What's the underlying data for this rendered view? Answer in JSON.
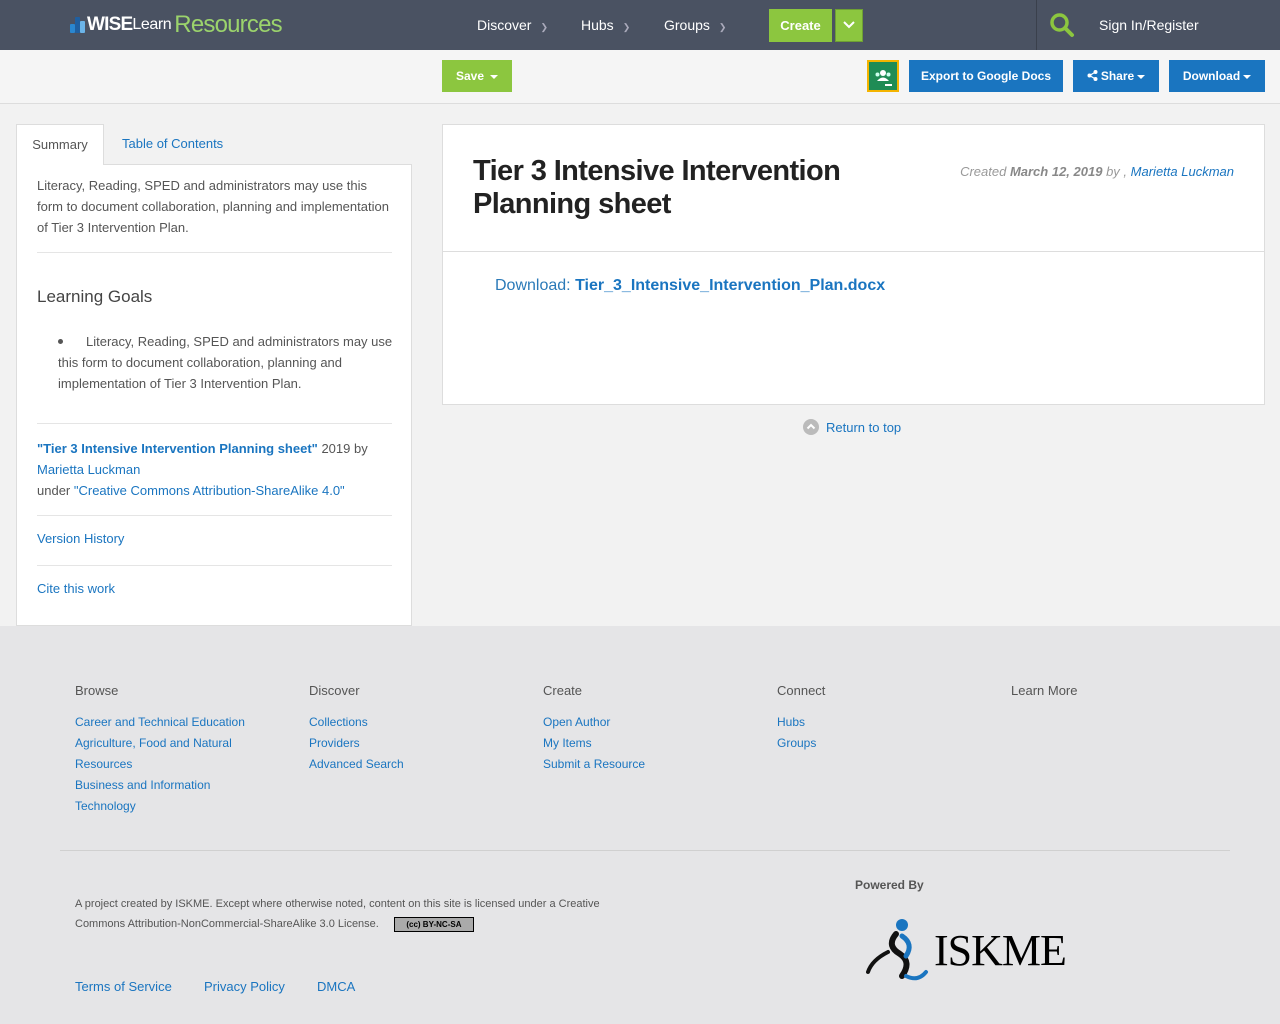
{
  "header": {
    "logo": {
      "wise": "WISE",
      "learn": "Learn",
      "resources": "Resources"
    },
    "nav": [
      {
        "label": "Discover"
      },
      {
        "label": "Hubs"
      },
      {
        "label": "Groups"
      }
    ],
    "create_label": "Create",
    "signin_label": "Sign In/Register"
  },
  "toolbar": {
    "save_label": "Save",
    "export_label": "Export to Google Docs",
    "share_label": "Share",
    "download_label": "Download"
  },
  "sidebar": {
    "tabs": {
      "summary": "Summary",
      "toc": "Table of Contents"
    },
    "summary_text": "Literacy, Reading, SPED and administrators may use this form to document collaboration, planning and implementation of Tier 3 Intervention Plan.",
    "learning_goals_heading": "Learning Goals",
    "learning_goals": [
      "Literacy, Reading, SPED and administrators may use this form to document collaboration, planning and implementation of Tier 3 Intervention Plan."
    ],
    "attribution": {
      "title": "\"Tier 3 Intensive Intervention Planning sheet\"",
      "year_by": "2019 by",
      "author": "Marietta Luckman",
      "under": "under",
      "license": "\"Creative Commons Attribution-ShareAlike 4.0\""
    },
    "version_history": "Version History",
    "cite": "Cite this work"
  },
  "resource": {
    "title": "Tier 3 Intensive Intervention Planning sheet",
    "created_prefix": "Created",
    "created_date": "March 12, 2019",
    "by": "by ,",
    "author": "Marietta Luckman",
    "download_prefix": "Download:",
    "download_file": "Tier_3_Intensive_Intervention_Plan.docx"
  },
  "return_to_top": "Return to top",
  "footer": {
    "columns": [
      {
        "heading": "Browse",
        "links": [
          "Career and Technical Education",
          "Agriculture, Food and Natural Resources",
          "Business and Information Technology"
        ]
      },
      {
        "heading": "Discover",
        "links": [
          "Collections",
          "Providers",
          "Advanced Search"
        ]
      },
      {
        "heading": "Create",
        "links": [
          "Open Author",
          "My Items",
          "Submit a Resource"
        ]
      },
      {
        "heading": "Connect",
        "links": [
          "Hubs",
          "Groups"
        ]
      },
      {
        "heading": "Learn More",
        "links": []
      }
    ],
    "license_note": "A project created by ISKME. Except where otherwise noted, content on this site is licensed under a Creative Commons Attribution-NonCommercial-ShareAlike 3.0 License.",
    "cc_badge": "(cc) BY-NC-SA",
    "legal_links": [
      "Terms of Service",
      "Privacy Policy",
      "DMCA"
    ],
    "powered_by": "Powered By",
    "iskme_logo": "ISKME"
  },
  "colors": {
    "nav_bg": "#4a5262",
    "green": "#8cc63f",
    "blue": "#1a75c0",
    "link": "#1a75c0",
    "footer_bg": "#e5e5e7"
  }
}
